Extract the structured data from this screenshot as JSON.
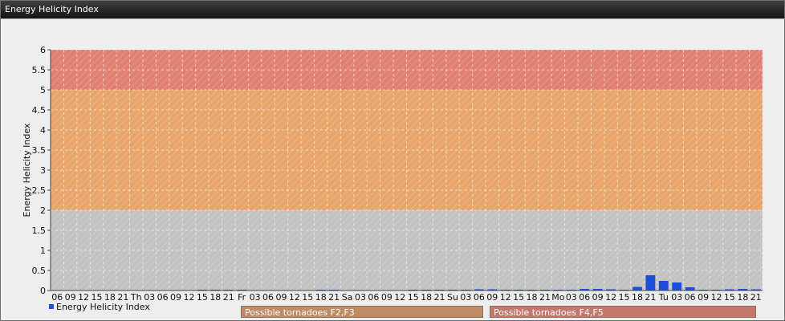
{
  "window": {
    "title": "Energy Helicity Index"
  },
  "legend": {
    "label": "Energy Helicity Index",
    "marker_color": "#1a4fd8"
  },
  "bands": [
    {
      "label": "Possible tornadoes F2,F3",
      "from": 2,
      "to": 5,
      "color": "#e8a56a"
    },
    {
      "label": "Possible tornadoes F4,F5",
      "from": 5,
      "to": 6,
      "color": "#e08070"
    }
  ],
  "chart_data": {
    "type": "bar",
    "title": "",
    "xlabel": "",
    "ylabel": "Energy Helicity Index",
    "ylim": [
      0,
      6
    ],
    "yticks": [
      "0",
      "0.5",
      "1",
      "1.5",
      "2",
      "2.5",
      "3",
      "3.5",
      "4",
      "4.5",
      "5",
      "5.5",
      "6"
    ],
    "grid": true,
    "legend_position": "bottom-left",
    "categories": [
      "06",
      "09",
      "12",
      "15",
      "18",
      "21",
      "Th",
      "03",
      "06",
      "09",
      "12",
      "15",
      "18",
      "21",
      "Fr",
      "03",
      "06",
      "09",
      "12",
      "15",
      "18",
      "21",
      "Sa",
      "03",
      "06",
      "09",
      "12",
      "15",
      "18",
      "21",
      "Su",
      "03",
      "06",
      "09",
      "12",
      "15",
      "18",
      "21",
      "Mo",
      "03",
      "06",
      "09",
      "12",
      "15",
      "18",
      "21",
      "Tu",
      "03",
      "06",
      "09",
      "12",
      "15",
      "18",
      "21"
    ],
    "series": [
      {
        "name": "Energy Helicity Index",
        "color": "#1a4fd8",
        "values": [
          0.01,
          0.01,
          0.01,
          0.01,
          0.01,
          0.01,
          0.01,
          0.01,
          0.01,
          0.01,
          0.01,
          0.02,
          0.02,
          0.02,
          0.02,
          0.01,
          0.01,
          0.01,
          0.01,
          0.01,
          0.02,
          0.02,
          0.01,
          0.01,
          0.01,
          0.01,
          0.01,
          0.02,
          0.02,
          0.02,
          0.02,
          0.02,
          0.03,
          0.03,
          0.02,
          0.02,
          0.02,
          0.02,
          0.02,
          0.02,
          0.04,
          0.04,
          0.03,
          0.02,
          0.09,
          0.38,
          0.24,
          0.2,
          0.08,
          0.02,
          0.02,
          0.03,
          0.04,
          0.03
        ]
      }
    ]
  }
}
